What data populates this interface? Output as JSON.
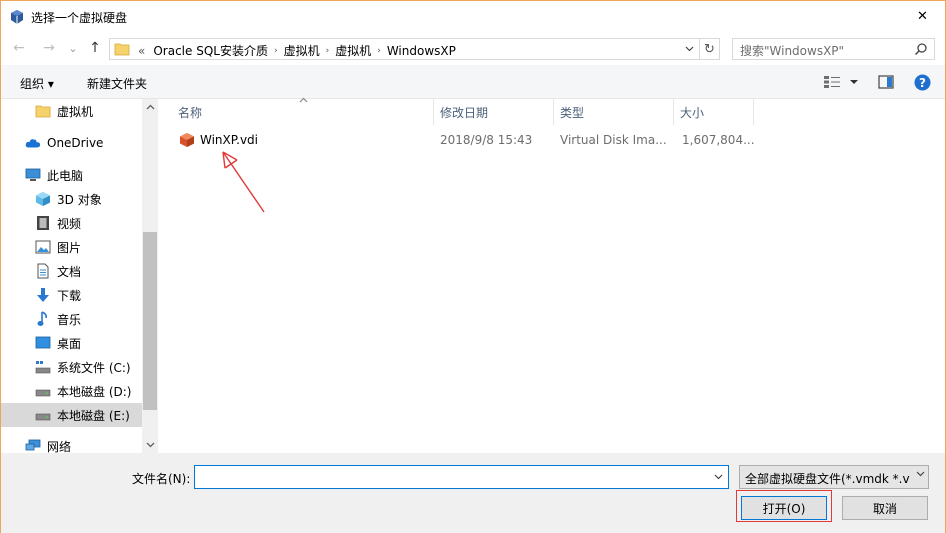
{
  "window": {
    "title": "选择一个虚拟硬盘",
    "close_glyph": "✕"
  },
  "nav": {
    "back_glyph": "←",
    "forward_glyph": "→",
    "recent_glyph": "⌄",
    "up_glyph": "↑"
  },
  "address": {
    "lead": "«",
    "crumbs": [
      "Oracle SQL安装介质",
      "虚拟机",
      "虚拟机",
      "WindowsXP"
    ],
    "sep_glyph": "›",
    "refresh_glyph": "↻"
  },
  "search": {
    "placeholder": "搜索\"WindowsXP\""
  },
  "toolbar": {
    "organize": "组织 ▾",
    "new_folder": "新建文件夹"
  },
  "sidebar": {
    "items": [
      {
        "label": "虚拟机",
        "icon": "folder-icon"
      },
      {
        "label": "OneDrive",
        "icon": "cloud-icon"
      },
      {
        "label": "此电脑",
        "icon": "computer-icon"
      },
      {
        "label": "3D 对象",
        "icon": "cube-icon"
      },
      {
        "label": "视频",
        "icon": "video-icon"
      },
      {
        "label": "图片",
        "icon": "picture-icon"
      },
      {
        "label": "文档",
        "icon": "document-icon"
      },
      {
        "label": "下载",
        "icon": "download-icon"
      },
      {
        "label": "音乐",
        "icon": "music-icon"
      },
      {
        "label": "桌面",
        "icon": "desktop-icon"
      },
      {
        "label": "系统文件 (C:)",
        "icon": "system-drive-icon"
      },
      {
        "label": "本地磁盘 (D:)",
        "icon": "drive-icon"
      },
      {
        "label": "本地磁盘 (E:)",
        "icon": "drive-icon",
        "selected": true
      },
      {
        "label": "网络",
        "icon": "network-icon"
      }
    ]
  },
  "columns": {
    "name": "名称",
    "date": "修改日期",
    "type": "类型",
    "size": "大小"
  },
  "files": [
    {
      "name": "WinXP.vdi",
      "date": "2018/9/8 15:43",
      "type": "Virtual Disk Ima...",
      "size": "1,607,804..."
    }
  ],
  "footer": {
    "filename_label": "文件名(N):",
    "filename_value": "",
    "filter": "全部虚拟硬盘文件(*.vmdk *.vd",
    "open": "打开(O)",
    "cancel": "取消"
  },
  "colors": {
    "annotation_red": "#e03a3a",
    "accent_blue": "#0078d7"
  }
}
